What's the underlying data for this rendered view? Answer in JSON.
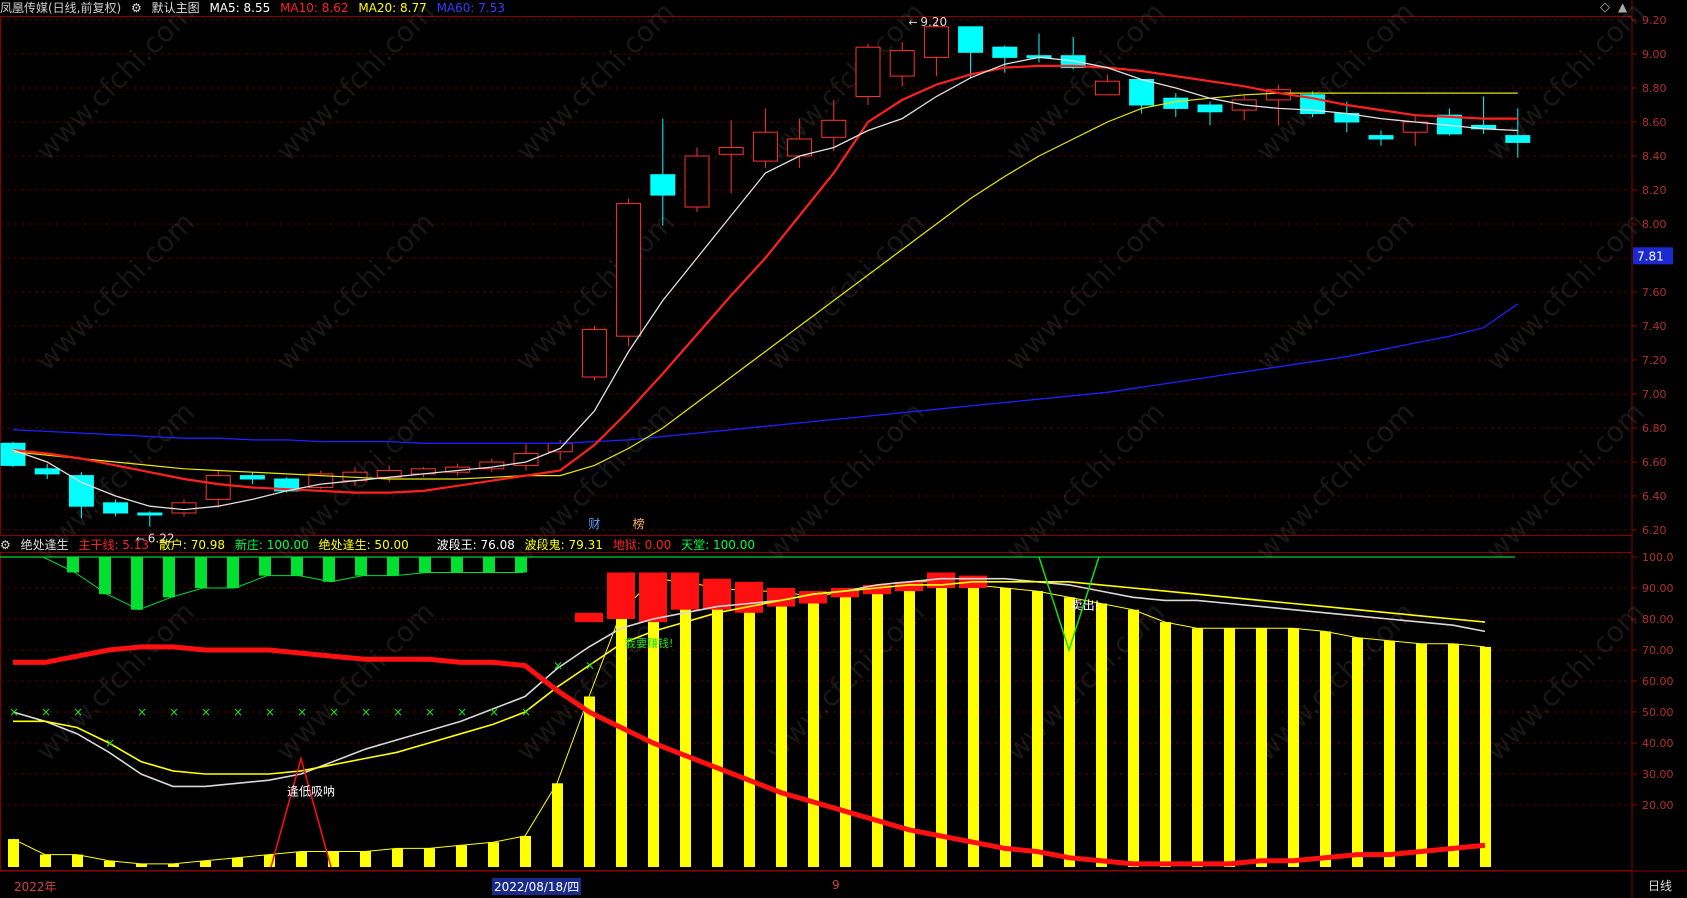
{
  "main_header": {
    "stock": "凤凰传媒(日线,前复权)",
    "setting_icon": "gear-icon",
    "template": "默认主图",
    "ma5": "MA5: 8.55",
    "ma10": "MA10: 8.62",
    "ma20": "MA20: 8.77",
    "ma60": "MA60: 7.53",
    "colors": {
      "ma5": "#ffffff",
      "ma10": "#ff2020",
      "ma20": "#ffff00",
      "ma60": "#2020ff"
    }
  },
  "ind_header": {
    "name": "绝处逢生",
    "items": [
      {
        "text": "主干线: 5.13",
        "color": "#ff2020"
      },
      {
        "text": "散户: 70.98",
        "color": "#ffff00"
      },
      {
        "text": "新庄: 100.00",
        "color": "#00ff40"
      },
      {
        "text": "绝处逢生: 50.00",
        "color": "#ffff00"
      },
      {
        "text": "波段王: 76.08",
        "color": "#ffffff"
      },
      {
        "text": "波段鬼: 79.31",
        "color": "#ffff00"
      },
      {
        "text": "地狱: 0.00",
        "color": "#ff2020"
      },
      {
        "text": "天堂: 100.00",
        "color": "#00ff40"
      }
    ]
  },
  "main_axis": [
    "9.20",
    "9.00",
    "8.80",
    "8.60",
    "8.40",
    "8.20",
    "8.00",
    "7.80",
    "7.60",
    "7.40",
    "7.20",
    "7.00",
    "6.80",
    "6.60",
    "6.40",
    "6.20"
  ],
  "ind_axis": [
    "100.0",
    "90.00",
    "80.00",
    "70.00",
    "60.00",
    "50.00",
    "40.00",
    "30.00",
    "20.00"
  ],
  "current_price": "7.81",
  "high_mark": "9.20",
  "low_mark": "6.22",
  "events": {
    "cai": "财",
    "bang": "榜"
  },
  "signals": {
    "buy": "逢低吸呐",
    "sell": "卖出!",
    "hint": "我要赚钱!"
  },
  "date_labels": {
    "year": "2022年",
    "selected": "2022/08/18/四",
    "month": "9"
  },
  "period": "日线",
  "watermark": "www.cfchi.com",
  "chart_data": {
    "type": "candlestick",
    "candles": [
      [
        6.71,
        6.58,
        6.72,
        6.57
      ],
      [
        6.56,
        6.53,
        6.59,
        6.5
      ],
      [
        6.52,
        6.34,
        6.54,
        6.27
      ],
      [
        6.36,
        6.3,
        6.38,
        6.28
      ],
      [
        6.3,
        6.29,
        6.31,
        6.22
      ],
      [
        6.3,
        6.36,
        6.38,
        6.28
      ],
      [
        6.38,
        6.52,
        6.55,
        6.33
      ],
      [
        6.52,
        6.5,
        6.54,
        6.47
      ],
      [
        6.5,
        6.43,
        6.51,
        6.42
      ],
      [
        6.45,
        6.53,
        6.55,
        6.44
      ],
      [
        6.49,
        6.54,
        6.57,
        6.46
      ],
      [
        6.51,
        6.55,
        6.58,
        6.48
      ],
      [
        6.53,
        6.56,
        6.57,
        6.51
      ],
      [
        6.54,
        6.57,
        6.59,
        6.52
      ],
      [
        6.56,
        6.6,
        6.62,
        6.54
      ],
      [
        6.58,
        6.65,
        6.71,
        6.55
      ],
      [
        6.66,
        6.71,
        6.73,
        6.61
      ],
      [
        7.1,
        7.38,
        7.4,
        7.08
      ],
      [
        7.34,
        8.12,
        8.15,
        7.28
      ],
      [
        8.29,
        8.17,
        8.62,
        7.99
      ],
      [
        8.1,
        8.4,
        8.45,
        8.07
      ],
      [
        8.41,
        8.45,
        8.61,
        8.18
      ],
      [
        8.37,
        8.54,
        8.68,
        8.33
      ],
      [
        8.4,
        8.5,
        8.62,
        8.33
      ],
      [
        8.51,
        8.61,
        8.73,
        8.43
      ],
      [
        8.75,
        9.04,
        9.06,
        8.7
      ],
      [
        8.87,
        9.02,
        9.07,
        8.81
      ],
      [
        8.98,
        9.16,
        9.2,
        8.87
      ],
      [
        9.16,
        9.01,
        9.16,
        8.86
      ],
      [
        9.04,
        8.98,
        9.05,
        8.89
      ],
      [
        8.99,
        8.98,
        9.12,
        8.95
      ],
      [
        8.99,
        8.92,
        9.1,
        8.91
      ],
      [
        8.76,
        8.84,
        8.88,
        8.76
      ],
      [
        8.85,
        8.7,
        8.85,
        8.65
      ],
      [
        8.74,
        8.68,
        8.77,
        8.63
      ],
      [
        8.7,
        8.66,
        8.72,
        8.58
      ],
      [
        8.67,
        8.73,
        8.76,
        8.61
      ],
      [
        8.73,
        8.79,
        8.82,
        8.58
      ],
      [
        8.76,
        8.65,
        8.78,
        8.63
      ],
      [
        8.65,
        8.6,
        8.72,
        8.54
      ],
      [
        8.52,
        8.5,
        8.55,
        8.46
      ],
      [
        8.54,
        8.6,
        8.64,
        8.46
      ],
      [
        8.64,
        8.53,
        8.68,
        8.52
      ],
      [
        8.58,
        8.56,
        8.75,
        8.53
      ],
      [
        8.52,
        8.48,
        8.68,
        8.39
      ]
    ],
    "ma5": [
      6.67,
      6.6,
      6.48,
      6.4,
      6.34,
      6.32,
      6.34,
      6.38,
      6.43,
      6.47,
      6.49,
      6.51,
      6.53,
      6.55,
      6.57,
      6.6,
      6.68,
      6.9,
      7.25,
      7.55,
      7.8,
      8.05,
      8.3,
      8.4,
      8.45,
      8.55,
      8.62,
      8.75,
      8.86,
      8.94,
      8.98,
      8.96,
      8.92,
      8.85,
      8.8,
      8.74,
      8.7,
      8.68,
      8.67,
      8.65,
      8.62,
      8.6,
      8.58,
      8.56,
      8.55
    ],
    "ma10": [
      6.67,
      6.65,
      6.62,
      6.58,
      6.54,
      6.5,
      6.47,
      6.45,
      6.44,
      6.43,
      6.42,
      6.42,
      6.43,
      6.46,
      6.49,
      6.52,
      6.55,
      6.7,
      6.9,
      7.12,
      7.35,
      7.58,
      7.8,
      8.05,
      8.3,
      8.6,
      8.73,
      8.82,
      8.88,
      8.92,
      8.93,
      8.93,
      8.92,
      8.9,
      8.87,
      8.84,
      8.81,
      8.77,
      8.74,
      8.7,
      8.67,
      8.64,
      8.63,
      8.62,
      8.62
    ],
    "ma20": [
      6.66,
      6.64,
      6.62,
      6.6,
      6.58,
      6.56,
      6.55,
      6.54,
      6.53,
      6.52,
      6.51,
      6.5,
      6.5,
      6.5,
      6.51,
      6.52,
      6.52,
      6.58,
      6.68,
      6.8,
      6.95,
      7.1,
      7.25,
      7.4,
      7.55,
      7.7,
      7.85,
      8.0,
      8.15,
      8.28,
      8.4,
      8.5,
      8.6,
      8.68,
      8.72,
      8.74,
      8.76,
      8.77,
      8.77,
      8.77,
      8.77,
      8.77,
      8.77,
      8.77,
      8.77
    ],
    "ma60": [
      6.79,
      6.78,
      6.77,
      6.76,
      6.75,
      6.74,
      6.74,
      6.73,
      6.73,
      6.72,
      6.72,
      6.72,
      6.71,
      6.71,
      6.71,
      6.71,
      6.71,
      6.72,
      6.73,
      6.75,
      6.77,
      6.79,
      6.81,
      6.83,
      6.85,
      6.87,
      6.89,
      6.91,
      6.93,
      6.95,
      6.97,
      6.99,
      7.01,
      7.04,
      7.07,
      7.1,
      7.13,
      7.16,
      7.19,
      7.22,
      7.26,
      7.3,
      7.34,
      7.39,
      7.53
    ],
    "ind_yellow_bars": [
      9,
      4,
      4,
      2,
      1,
      1,
      2,
      3,
      4,
      5,
      5,
      5,
      6,
      6,
      7,
      8,
      10,
      27,
      55,
      82,
      93,
      92,
      90,
      89,
      89,
      87,
      89,
      91,
      92,
      92,
      91,
      90,
      89,
      87,
      85,
      83,
      79,
      77,
      77,
      77,
      77,
      76,
      74,
      73,
      72,
      72,
      71
    ],
    "ind_main_line": [
      66,
      66,
      68,
      70,
      71,
      71,
      70,
      70,
      70,
      69,
      68,
      67,
      67,
      67,
      66,
      66,
      65,
      57,
      50,
      45,
      40,
      36,
      32,
      28,
      24,
      21,
      18,
      15,
      12,
      10,
      8,
      6,
      5,
      3,
      2,
      1,
      1,
      1,
      1,
      2,
      2,
      3,
      4,
      4,
      5,
      6,
      7
    ],
    "ind_white_line": [
      50,
      47,
      43,
      37,
      30,
      26,
      26,
      27,
      28,
      30,
      34,
      38,
      41,
      44,
      47,
      51,
      55,
      64,
      71,
      77,
      80,
      82,
      84,
      85,
      86,
      88,
      89,
      91,
      92,
      93,
      93,
      93,
      92,
      91,
      89,
      87,
      86,
      86,
      85,
      84,
      83,
      82,
      81,
      80,
      79,
      78,
      76
    ],
    "ind_yellow_line": [
      47,
      47,
      45,
      40,
      34,
      31,
      30,
      30,
      30,
      31,
      33,
      35,
      37,
      40,
      43,
      46,
      50,
      58,
      65,
      72,
      76,
      79,
      82,
      84,
      86,
      88,
      89,
      90,
      91,
      91,
      92,
      92,
      92,
      92,
      91,
      90,
      89,
      88,
      87,
      86,
      85,
      84,
      83,
      82,
      81,
      80,
      79
    ],
    "ind_green_marks": [
      50,
      50,
      50,
      40,
      50,
      50,
      50,
      50,
      50,
      50,
      50,
      50,
      50,
      50,
      50,
      50,
      50,
      65,
      65
    ]
  }
}
